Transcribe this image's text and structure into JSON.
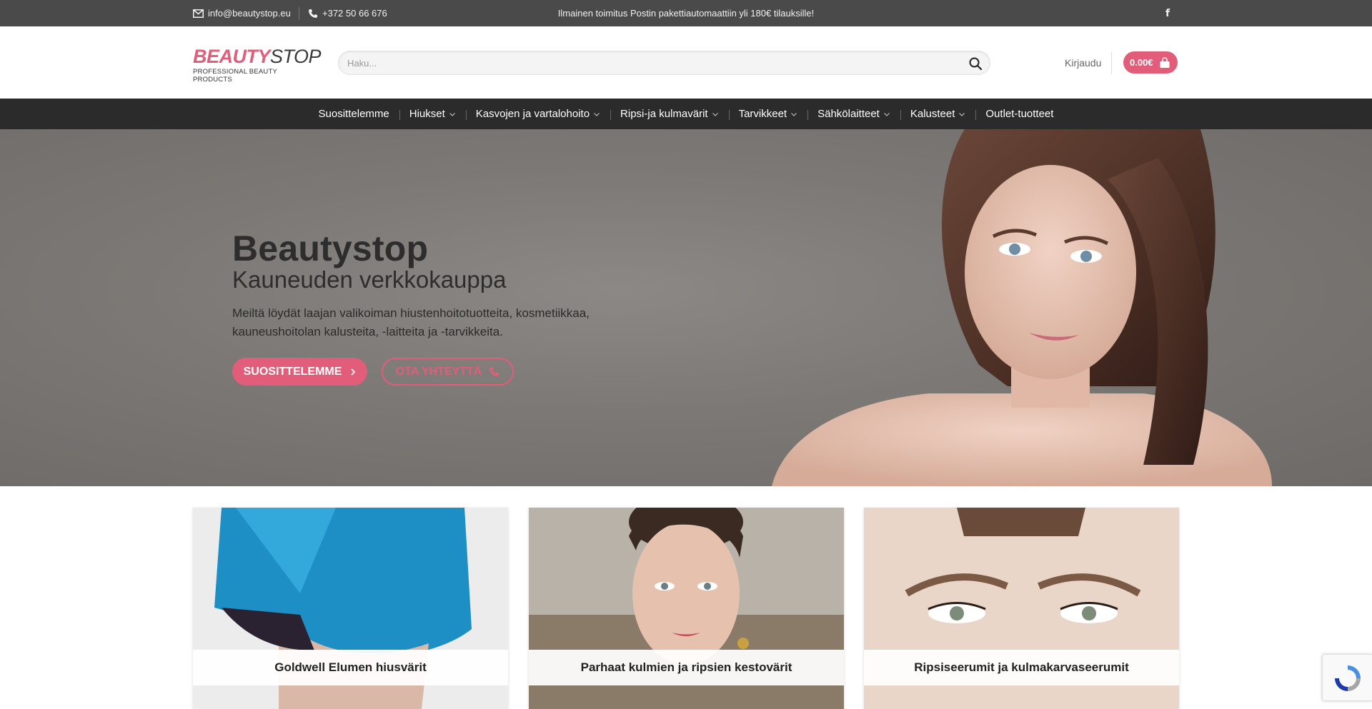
{
  "topbar": {
    "email": "info@beautystop.eu",
    "phone": "+372 50 66 676",
    "promo": "Ilmainen toimitus Postin pakettiautomaattiin yli 180€ tilauksille!",
    "facebook": "f"
  },
  "header": {
    "logo_main_1": "BEAUTY",
    "logo_main_2": "STOP",
    "logo_sub": "PROFESSIONAL BEAUTY PRODUCTS",
    "search_placeholder": "Haku...",
    "login": "Kirjaudu",
    "cart_total": "0.00€"
  },
  "nav": {
    "items": [
      {
        "label": "Suosittelemme"
      },
      {
        "label": "Hiukset"
      },
      {
        "label": "Kasvojen ja vartalohoito"
      },
      {
        "label": "Ripsi-ja kulmavärit"
      },
      {
        "label": "Tarvikkeet"
      },
      {
        "label": "Sähkölaitteet"
      },
      {
        "label": "Kalusteet"
      },
      {
        "label": "Outlet-tuotteet"
      }
    ]
  },
  "hero": {
    "title": "Beautystop",
    "subtitle": "Kauneuden verkkokauppa",
    "text": "Meiltä löydät laajan valikoiman hiustenhoitotuotteita, kosmetiikkaa, kauneushoitolan kalusteita, -laitteita ja -tarvikkeita.",
    "primary_button": "SUOSITTELEMME",
    "secondary_button": "OTA YHTEYTTÄ"
  },
  "cards": [
    {
      "label": "Goldwell Elumen hiusvärit"
    },
    {
      "label": "Parhaat kulmien ja ripsien kestovärit"
    },
    {
      "label": "Ripsiseerumit ja kulmakarvaseerumit"
    }
  ],
  "colors": {
    "brand": "#e25d7a",
    "topbar": "#4a4a4a",
    "nav": "#2b2b2b"
  }
}
